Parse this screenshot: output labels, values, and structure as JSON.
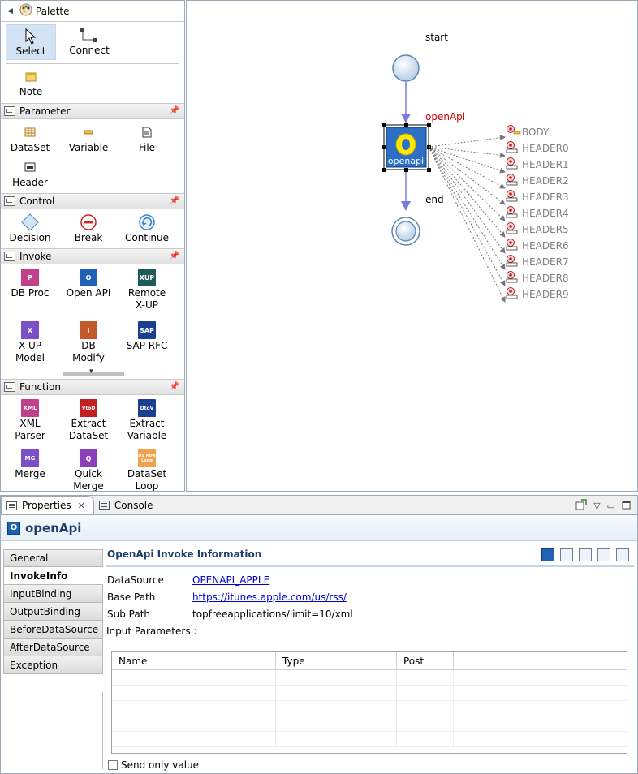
{
  "palette": {
    "title": "Palette",
    "tools": [
      {
        "label": "Select",
        "icon": "cursor-arrow-icon",
        "selected": true
      },
      {
        "label": "Connect",
        "icon": "connection-icon",
        "selected": false
      }
    ],
    "note_label": "Note",
    "drawers": {
      "parameter": {
        "title": "Parameter",
        "items": [
          "DataSet",
          "Variable",
          "File",
          "Header"
        ]
      },
      "control": {
        "title": "Control",
        "items": [
          "Decision",
          "Break",
          "Continue"
        ]
      },
      "invoke": {
        "title": "Invoke",
        "items": [
          "DB Proc",
          "Open API",
          "Remote\nX-UP",
          "X-UP\nModel",
          "DB\nModify",
          "SAP RFC"
        ]
      },
      "function": {
        "title": "Function",
        "items": [
          "XML\nParser",
          "Extract\nDataSet",
          "Extract\nVariable",
          "Merge",
          "Quick\nMerge",
          "DataSet\nLoop"
        ]
      }
    },
    "invoke_icon_text": {
      "dbproc": "P",
      "openapi": "O",
      "remote": "XUP",
      "xupmodel": "X",
      "dbmodify": "i",
      "sap": "SAP"
    },
    "function_icon_text": {
      "xml": "XML",
      "vtod": "VtoD",
      "dtov": "DtoV",
      "merge": "MG",
      "quick": "Q",
      "loop": "DS Row Loop"
    }
  },
  "canvas": {
    "start_label": "start",
    "end_label": "end",
    "node_label": "openApi",
    "node_icon_text": "openapi",
    "outputs": [
      "BODY",
      "HEADER0",
      "HEADER1",
      "HEADER2",
      "HEADER3",
      "HEADER4",
      "HEADER5",
      "HEADER6",
      "HEADER7",
      "HEADER8",
      "HEADER9"
    ]
  },
  "panel": {
    "tabs": [
      {
        "label": "Properties",
        "active": true
      },
      {
        "label": "Console",
        "active": false
      }
    ],
    "title": "openApi",
    "side_tabs": [
      "General",
      "InvokeInfo",
      "InputBinding",
      "OutputBinding",
      "BeforeDataSource",
      "AfterDataSource",
      "Exception"
    ],
    "active_side_tab": "InvokeInfo",
    "section_title": "OpenApi Invoke Information",
    "fields": {
      "datasource_label": "DataSource",
      "datasource_value": "OPENAPI_APPLE",
      "basepath_label": "Base Path",
      "basepath_value": "https://itunes.apple.com/us/rss/",
      "subpath_label": "Sub Path",
      "subpath_value": "topfreeapplications/limit=10/xml",
      "input_params_label": "Input Parameters :"
    },
    "table_headers": [
      "Name",
      "Type",
      "Post"
    ],
    "send_only_value_label": "Send only value"
  },
  "colors": {
    "accent": "#1f62b5",
    "flow_arrow": "#7b7bdf",
    "node_label": "#cc0000",
    "output_text": "#808080"
  }
}
